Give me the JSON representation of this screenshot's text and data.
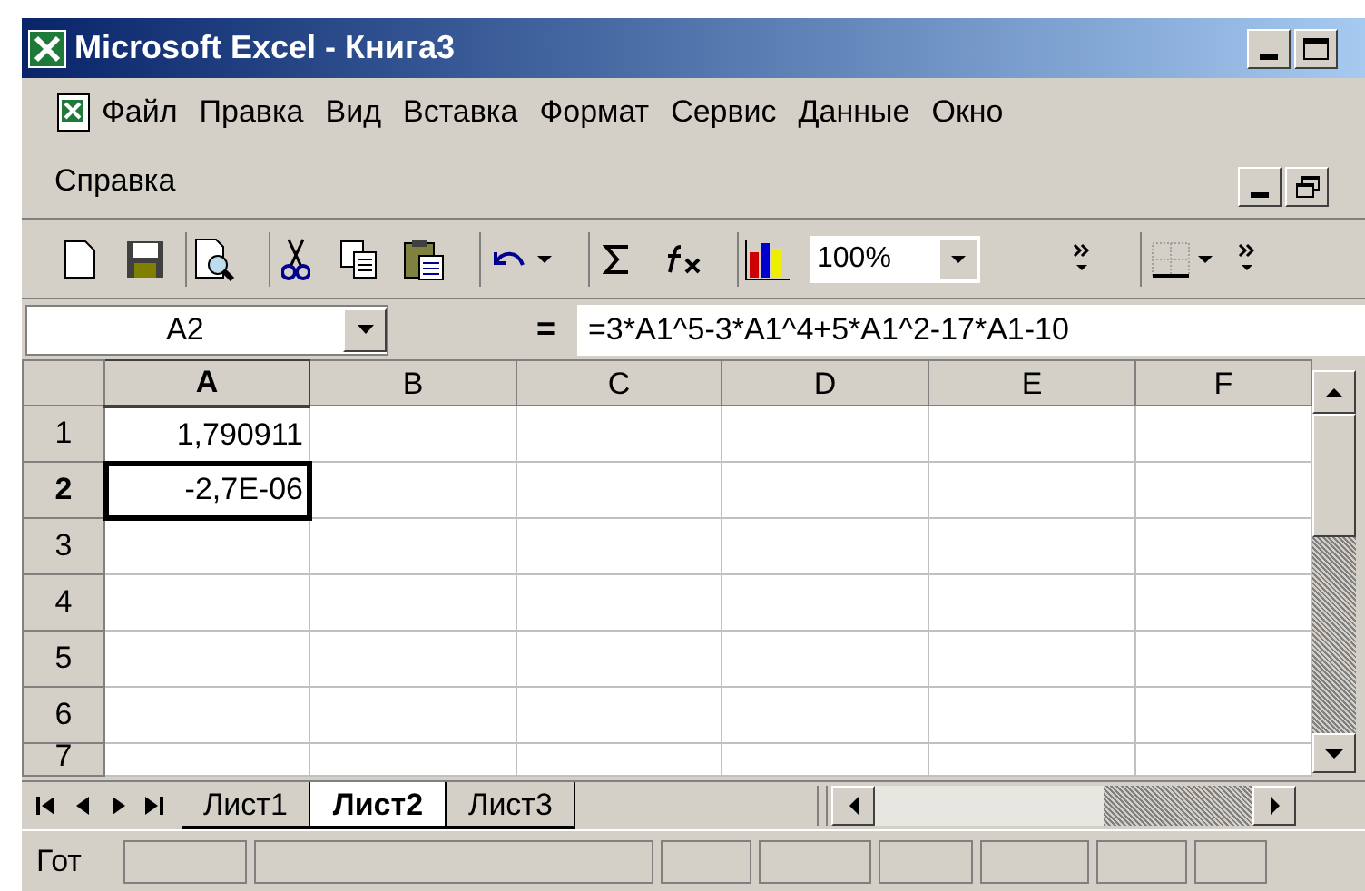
{
  "window": {
    "title": "Microsoft Excel - Книга3"
  },
  "menu": [
    {
      "label": "Файл"
    },
    {
      "label": "Правка"
    },
    {
      "label": "Вид"
    },
    {
      "label": "Вставка"
    },
    {
      "label": "Формат"
    },
    {
      "label": "Сервис"
    },
    {
      "label": "Данные"
    },
    {
      "label": "Окно"
    },
    {
      "label": "Справка"
    }
  ],
  "toolbar": {
    "zoom": "100%"
  },
  "formula_bar": {
    "name_box": "A2",
    "equals": "=",
    "formula": "=3*A1^5-3*A1^4+5*A1^2-17*A1-10"
  },
  "sheet": {
    "columns": [
      {
        "label": "A",
        "selected": true
      },
      {
        "label": "B",
        "selected": false
      },
      {
        "label": "C",
        "selected": false
      },
      {
        "label": "D",
        "selected": false
      },
      {
        "label": "E",
        "selected": false
      },
      {
        "label": "F",
        "selected": false
      }
    ],
    "rows": [
      {
        "header": "1",
        "selected": false,
        "cells": [
          {
            "value": "1,790911",
            "selected": false
          }
        ]
      },
      {
        "header": "2",
        "selected": true,
        "cells": [
          {
            "value": "-2,7E-06",
            "selected": true
          }
        ]
      },
      {
        "header": "3",
        "selected": false,
        "cells": []
      },
      {
        "header": "4",
        "selected": false,
        "cells": []
      },
      {
        "header": "5",
        "selected": false,
        "cells": []
      },
      {
        "header": "6",
        "selected": false,
        "cells": []
      },
      {
        "header": "7",
        "selected": false,
        "cells": []
      }
    ]
  },
  "sheet_tabs": [
    {
      "label": "Лист1",
      "selected": false
    },
    {
      "label": "Лист2",
      "selected": true
    },
    {
      "label": "Лист3",
      "selected": false
    }
  ],
  "status_bar": {
    "text": "Гот"
  }
}
